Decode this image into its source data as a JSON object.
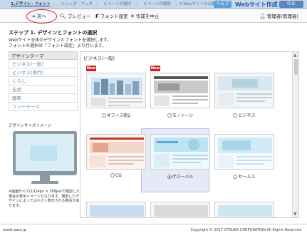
{
  "steps": [
    {
      "label": "1.デザイン・フォント",
      "active": true
    },
    {
      "label": "2.ヘッダ・フッタ",
      "active": false
    },
    {
      "label": "3.ページの選択",
      "active": false
    },
    {
      "label": "4.ページの編集",
      "active": false
    },
    {
      "label": "5.Webサイトの公開",
      "active": false
    }
  ],
  "header": {
    "help_label": "ヘルプ",
    "app_title": "Webサイト作成",
    "cancel_label": "中止"
  },
  "toolbar": {
    "next_label": "次へ",
    "preview_label": "プレビュー",
    "font_label": "フォント設定",
    "cancel_label": "作成を中止",
    "user_label": "管理者(管理者)"
  },
  "main": {
    "heading": "ステップ 1. デザインとフォントの選択",
    "desc1": "Webサイト全体のデザインとフォントを選択します。",
    "desc2": "フォントの選択は「フォント設定」より行います。"
  },
  "sidebar": {
    "title": "デザインテーマ",
    "items": [
      "ビジネス(一般)",
      "ビジネス(専門)",
      "くらし",
      "自然",
      "趣味",
      "フリーテーマ"
    ],
    "size_label": "デザインサイズイメージ",
    "note": "※画面サイズ(1024px × 768px)で確認した場合の表示イメージとなります。選択したデザインによっては小さく表示される場合があります。"
  },
  "panel": {
    "title": "ビジネス(一般)",
    "selected_index": 4,
    "themes": [
      {
        "label": "オフィス街2",
        "new": true
      },
      {
        "label": "モノトーン",
        "new": true
      },
      {
        "label": "ビジネス",
        "new": false
      },
      {
        "label": "CG",
        "new": false
      },
      {
        "label": "グローバル",
        "new": false
      },
      {
        "label": "セールス",
        "new": false
      }
    ]
  },
  "colors": {
    "accent": "#1c5fa6",
    "step_bar": "#c7d8ea",
    "selected_bg": "#e6eaf8",
    "highlight_ring": "#d62020"
  },
  "footer": {
    "left": "aweb-pass.jp",
    "right": "Copyright © 2017 OTSUKA CORPORATION All Rights Reserved"
  }
}
